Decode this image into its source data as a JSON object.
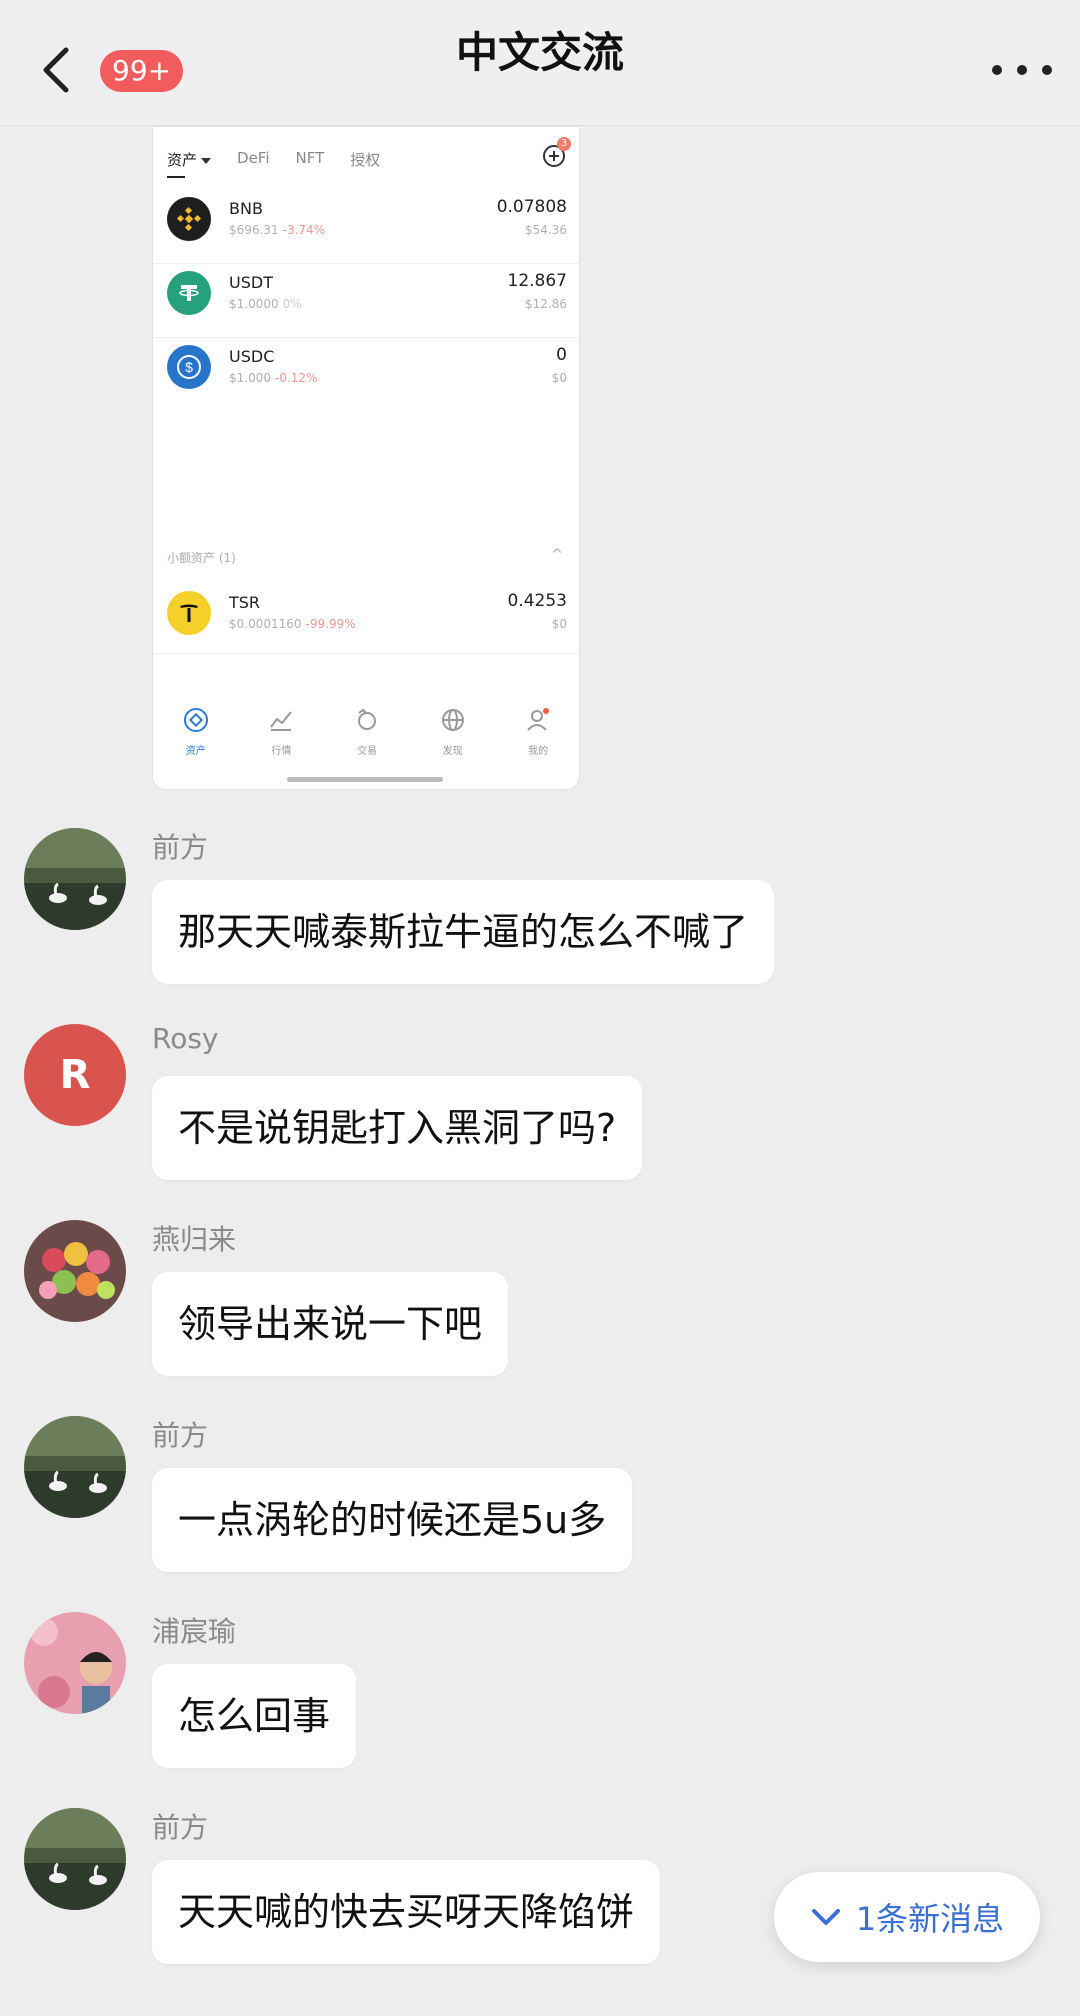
{
  "header": {
    "title": "中文交流",
    "unread_badge": "99+"
  },
  "screenshot": {
    "tabs": [
      {
        "label": "资产",
        "active": true
      },
      {
        "label": "DeFi",
        "active": false
      },
      {
        "label": "NFT",
        "active": false
      },
      {
        "label": "授权",
        "active": false
      }
    ],
    "add_badge": "3",
    "assets": [
      {
        "name": "BNB",
        "price": "$696.31",
        "change": "-3.74%",
        "amount": "0.07808",
        "value": "$54.36",
        "icon": "bnb-coin-icon",
        "color": "#1e1e1e"
      },
      {
        "name": "USDT",
        "price": "$1.0000",
        "change": "0%",
        "amount": "12.867",
        "value": "$12.86",
        "icon": "usdt-coin-icon",
        "color": "#26a17b"
      },
      {
        "name": "USDC",
        "price": "$1.000",
        "change": "-0.12%",
        "amount": "0",
        "value": "$0",
        "icon": "usdc-coin-icon",
        "color": "#2775ca"
      }
    ],
    "small_assets_label": "小额资产 (1)",
    "small_assets": [
      {
        "name": "TSR",
        "price": "$0.0001160",
        "change": "-99.99%",
        "amount": "0.4253",
        "value": "$0",
        "icon": "tsr-coin-icon",
        "color": "#f5cf2a"
      }
    ],
    "nav": [
      {
        "label": "资产",
        "icon": "asset-icon",
        "active": true
      },
      {
        "label": "行情",
        "icon": "chart-icon",
        "active": false
      },
      {
        "label": "交易",
        "icon": "exchange-icon",
        "active": false
      },
      {
        "label": "发现",
        "icon": "globe-icon",
        "active": false
      },
      {
        "label": "我的",
        "icon": "profile-icon",
        "active": false
      }
    ]
  },
  "messages": [
    {
      "sender": "前方",
      "text": "那天天喊泰斯拉牛逼的怎么不喊了",
      "avatar": "swan-avatar"
    },
    {
      "sender": "Rosy",
      "text": "不是说钥匙打入黑洞了吗?",
      "avatar": "letter-avatar",
      "avatar_letter": "R"
    },
    {
      "sender": "燕归来",
      "text": "领导出来说一下吧",
      "avatar": "fruit-avatar"
    },
    {
      "sender": "前方",
      "text": "一点涡轮的时候还是5u多",
      "avatar": "swan-avatar"
    },
    {
      "sender": "浦宸瑜",
      "text": "怎么回事",
      "avatar": "portrait-avatar"
    },
    {
      "sender": "前方",
      "text": "天天喊的快去买呀天降馅饼",
      "avatar": "swan-avatar"
    }
  ],
  "new_message_pill": "1条新消息",
  "colors": {
    "background": "#ededed",
    "badge": "#f25c5c",
    "link_blue": "#3b6fd1",
    "rosy_avatar": "#d9534f"
  }
}
